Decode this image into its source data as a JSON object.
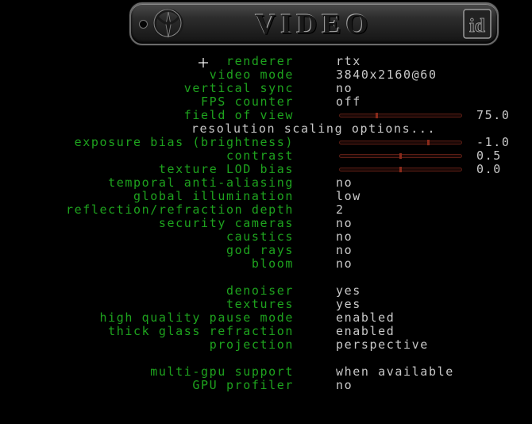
{
  "header": {
    "title": "VIDEO",
    "logo_icon": "quake-logo-icon",
    "badge_icon": "id-software-icon"
  },
  "colors": {
    "label": "#1ea31e",
    "value": "#c8c8c8",
    "slider": "#5a1d14"
  },
  "menu": {
    "items": [
      {
        "label": "renderer",
        "value": "rtx"
      },
      {
        "label": "video mode",
        "value": "3840x2160@60"
      },
      {
        "label": "vertical sync",
        "value": "no"
      },
      {
        "label": "FPS counter",
        "value": "off"
      },
      {
        "label": "field of view",
        "slider_value": "75.0",
        "slider_level": 0.3
      },
      {
        "section": "resolution scaling options..."
      },
      {
        "label": "exposure bias (brightness)",
        "slider_value": "-1.0",
        "slider_level": 0.73
      },
      {
        "label": "contrast",
        "slider_value": "0.5",
        "slider_level": 0.5
      },
      {
        "label": "texture LOD bias",
        "slider_value": "0.0",
        "slider_level": 0.5
      },
      {
        "label": "temporal anti-aliasing",
        "value": "no"
      },
      {
        "label": "global illumination",
        "value": "low"
      },
      {
        "label": "reflection/refraction depth",
        "value": "2"
      },
      {
        "label": "security cameras",
        "value": "no"
      },
      {
        "label": "caustics",
        "value": "no"
      },
      {
        "label": "god rays",
        "value": "no"
      },
      {
        "label": "bloom",
        "value": "no"
      },
      {
        "spacer": true
      },
      {
        "label": "denoiser",
        "value": "yes"
      },
      {
        "label": "textures",
        "value": "yes"
      },
      {
        "label": "high quality pause mode",
        "value": "enabled"
      },
      {
        "label": "thick glass refraction",
        "value": "enabled"
      },
      {
        "label": "projection",
        "value": "perspective"
      },
      {
        "spacer": true
      },
      {
        "label": "multi-gpu support",
        "value": "when available"
      },
      {
        "label": "GPU profiler",
        "value": "no"
      }
    ]
  }
}
